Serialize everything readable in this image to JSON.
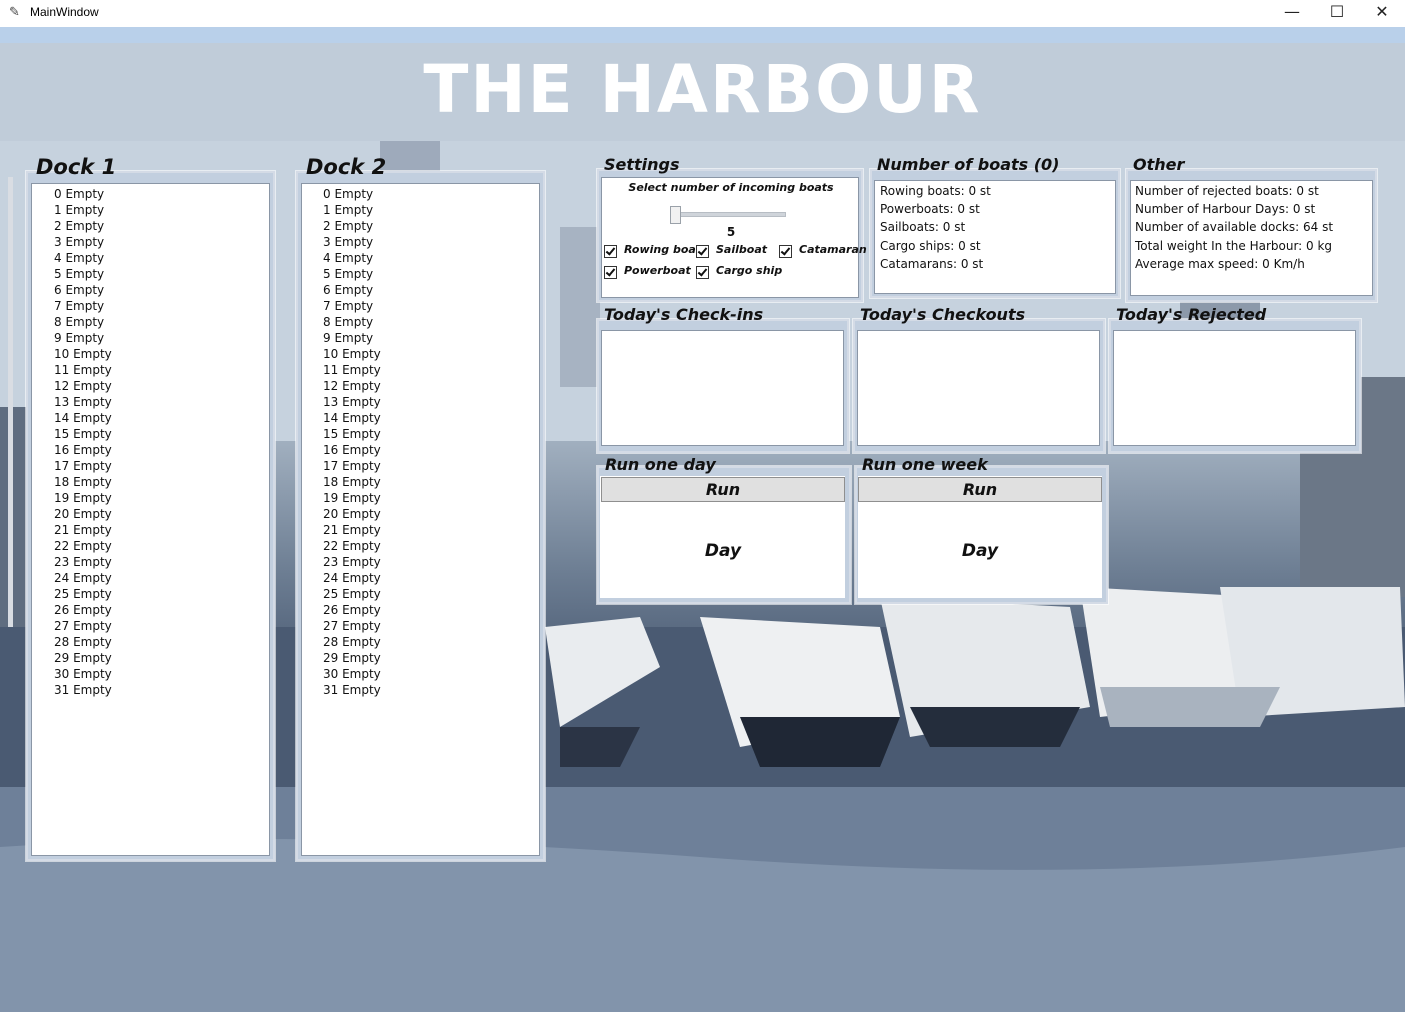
{
  "window": {
    "title": "MainWindow",
    "app_icon": "feather-app-icon",
    "minimize": "—",
    "maximize": "☐",
    "close": "✕"
  },
  "banner": {
    "title": "THE HARBOUR"
  },
  "dock1": {
    "title": "Dock 1",
    "slots": [
      "0 Empty",
      "1 Empty",
      "2 Empty",
      "3 Empty",
      "4 Empty",
      "5 Empty",
      "6 Empty",
      "7 Empty",
      "8 Empty",
      "9 Empty",
      "10 Empty",
      "11 Empty",
      "12 Empty",
      "13 Empty",
      "14 Empty",
      "15 Empty",
      "16 Empty",
      "17 Empty",
      "18 Empty",
      "19 Empty",
      "20 Empty",
      "21 Empty",
      "22 Empty",
      "23 Empty",
      "24 Empty",
      "25 Empty",
      "26 Empty",
      "27 Empty",
      "28 Empty",
      "29 Empty",
      "30 Empty",
      "31 Empty"
    ]
  },
  "dock2": {
    "title": "Dock 2",
    "slots": [
      "0 Empty",
      "1 Empty",
      "2 Empty",
      "3 Empty",
      "4 Empty",
      "5 Empty",
      "6 Empty",
      "7 Empty",
      "8 Empty",
      "9 Empty",
      "10 Empty",
      "11 Empty",
      "12 Empty",
      "13 Empty",
      "14 Empty",
      "15 Empty",
      "16 Empty",
      "17 Empty",
      "18 Empty",
      "19 Empty",
      "20 Empty",
      "21 Empty",
      "22 Empty",
      "23 Empty",
      "24 Empty",
      "25 Empty",
      "26 Empty",
      "27 Empty",
      "28 Empty",
      "29 Empty",
      "30 Empty",
      "31 Empty"
    ]
  },
  "settings": {
    "title": "Settings",
    "slider_label": "Select number of incoming boats",
    "slider_value": "5",
    "checkboxes": {
      "rowing": {
        "label": "Rowing boat",
        "checked": true
      },
      "sail": {
        "label": "Sailboat",
        "checked": true
      },
      "catamaran": {
        "label": "Catamaran",
        "checked": true
      },
      "power": {
        "label": "Powerboat",
        "checked": true
      },
      "cargo": {
        "label": "Cargo ship",
        "checked": true
      }
    }
  },
  "boats": {
    "title": "Number of boats (0)",
    "lines": [
      "Rowing boats: 0 st",
      "Powerboats: 0 st",
      "Sailboats: 0 st",
      "Cargo ships: 0 st",
      "Catamarans: 0 st"
    ]
  },
  "other": {
    "title": "Other",
    "lines": [
      "Number of rejected boats: 0 st",
      "Number of Harbour Days: 0 st",
      "Number of available docks: 64 st",
      "Total weight In the Harbour: 0 kg",
      "Average max speed: 0 Km/h"
    ]
  },
  "checkins": {
    "title": "Today's Check-ins"
  },
  "checkouts": {
    "title": "Today's Checkouts"
  },
  "rejected": {
    "title": "Today's Rejected"
  },
  "run_day": {
    "title": "Run one day",
    "button": "Run",
    "label": "Day"
  },
  "run_week": {
    "title": "Run one week",
    "button": "Run",
    "label": "Day"
  },
  "colors": {
    "banner": "#c0ccd9",
    "frame": "#c2cfdf",
    "top_strip": "#b9d0ea"
  }
}
